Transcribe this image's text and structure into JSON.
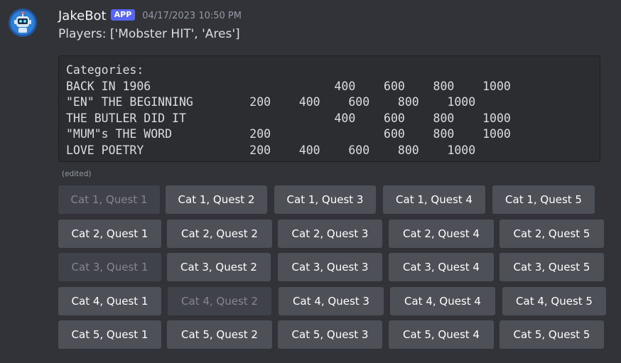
{
  "author": {
    "name": "JakeBot",
    "badge": "APP",
    "timestamp": "04/17/2023 10:50 PM",
    "avatar_icon": "robot-avatar-icon"
  },
  "message": {
    "players_line": "Players: ['Mobster HIT', 'Ares']",
    "code_lines": [
      "Categories:",
      "BACK IN 1906                          400    600    800    1000",
      "\"EN\" THE BEGINNING        200    400    600    800    1000",
      "THE BUTLER DID IT                     400    600    800    1000",
      "\"MUM\"s THE WORD           200                600    800    1000",
      "LOVE POETRY               200    400    600    800    1000"
    ],
    "edited_label": "(edited)"
  },
  "buttons": [
    [
      {
        "label": "Cat 1, Quest 1",
        "disabled": true
      },
      {
        "label": "Cat 1, Quest 2",
        "disabled": false
      },
      {
        "label": "Cat 1, Quest 3",
        "disabled": false
      },
      {
        "label": "Cat 1, Quest 4",
        "disabled": false
      },
      {
        "label": "Cat 1, Quest 5",
        "disabled": false
      }
    ],
    [
      {
        "label": "Cat 2, Quest 1",
        "disabled": false
      },
      {
        "label": "Cat 2, Quest 2",
        "disabled": false
      },
      {
        "label": "Cat 2, Quest 3",
        "disabled": false
      },
      {
        "label": "Cat 2, Quest 4",
        "disabled": false
      },
      {
        "label": "Cat 2, Quest 5",
        "disabled": false
      }
    ],
    [
      {
        "label": "Cat 3, Quest 1",
        "disabled": true
      },
      {
        "label": "Cat 3, Quest 2",
        "disabled": false
      },
      {
        "label": "Cat 3, Quest 3",
        "disabled": false
      },
      {
        "label": "Cat 3, Quest 4",
        "disabled": false
      },
      {
        "label": "Cat 3, Quest 5",
        "disabled": false
      }
    ],
    [
      {
        "label": "Cat 4, Quest 1",
        "disabled": false
      },
      {
        "label": "Cat 4, Quest 2",
        "disabled": true
      },
      {
        "label": "Cat 4, Quest 3",
        "disabled": false
      },
      {
        "label": "Cat 4, Quest 4",
        "disabled": false
      },
      {
        "label": "Cat 4, Quest 5",
        "disabled": false
      }
    ],
    [
      {
        "label": "Cat 5, Quest 1",
        "disabled": false
      },
      {
        "label": "Cat 5, Quest 2",
        "disabled": false
      },
      {
        "label": "Cat 5, Quest 3",
        "disabled": false
      },
      {
        "label": "Cat 5, Quest 4",
        "disabled": false
      },
      {
        "label": "Cat 5, Quest 5",
        "disabled": false
      }
    ]
  ],
  "colors": {
    "background": "#313338",
    "button": "#4e5058",
    "button_disabled": "#404249",
    "badge": "#5865f2"
  }
}
